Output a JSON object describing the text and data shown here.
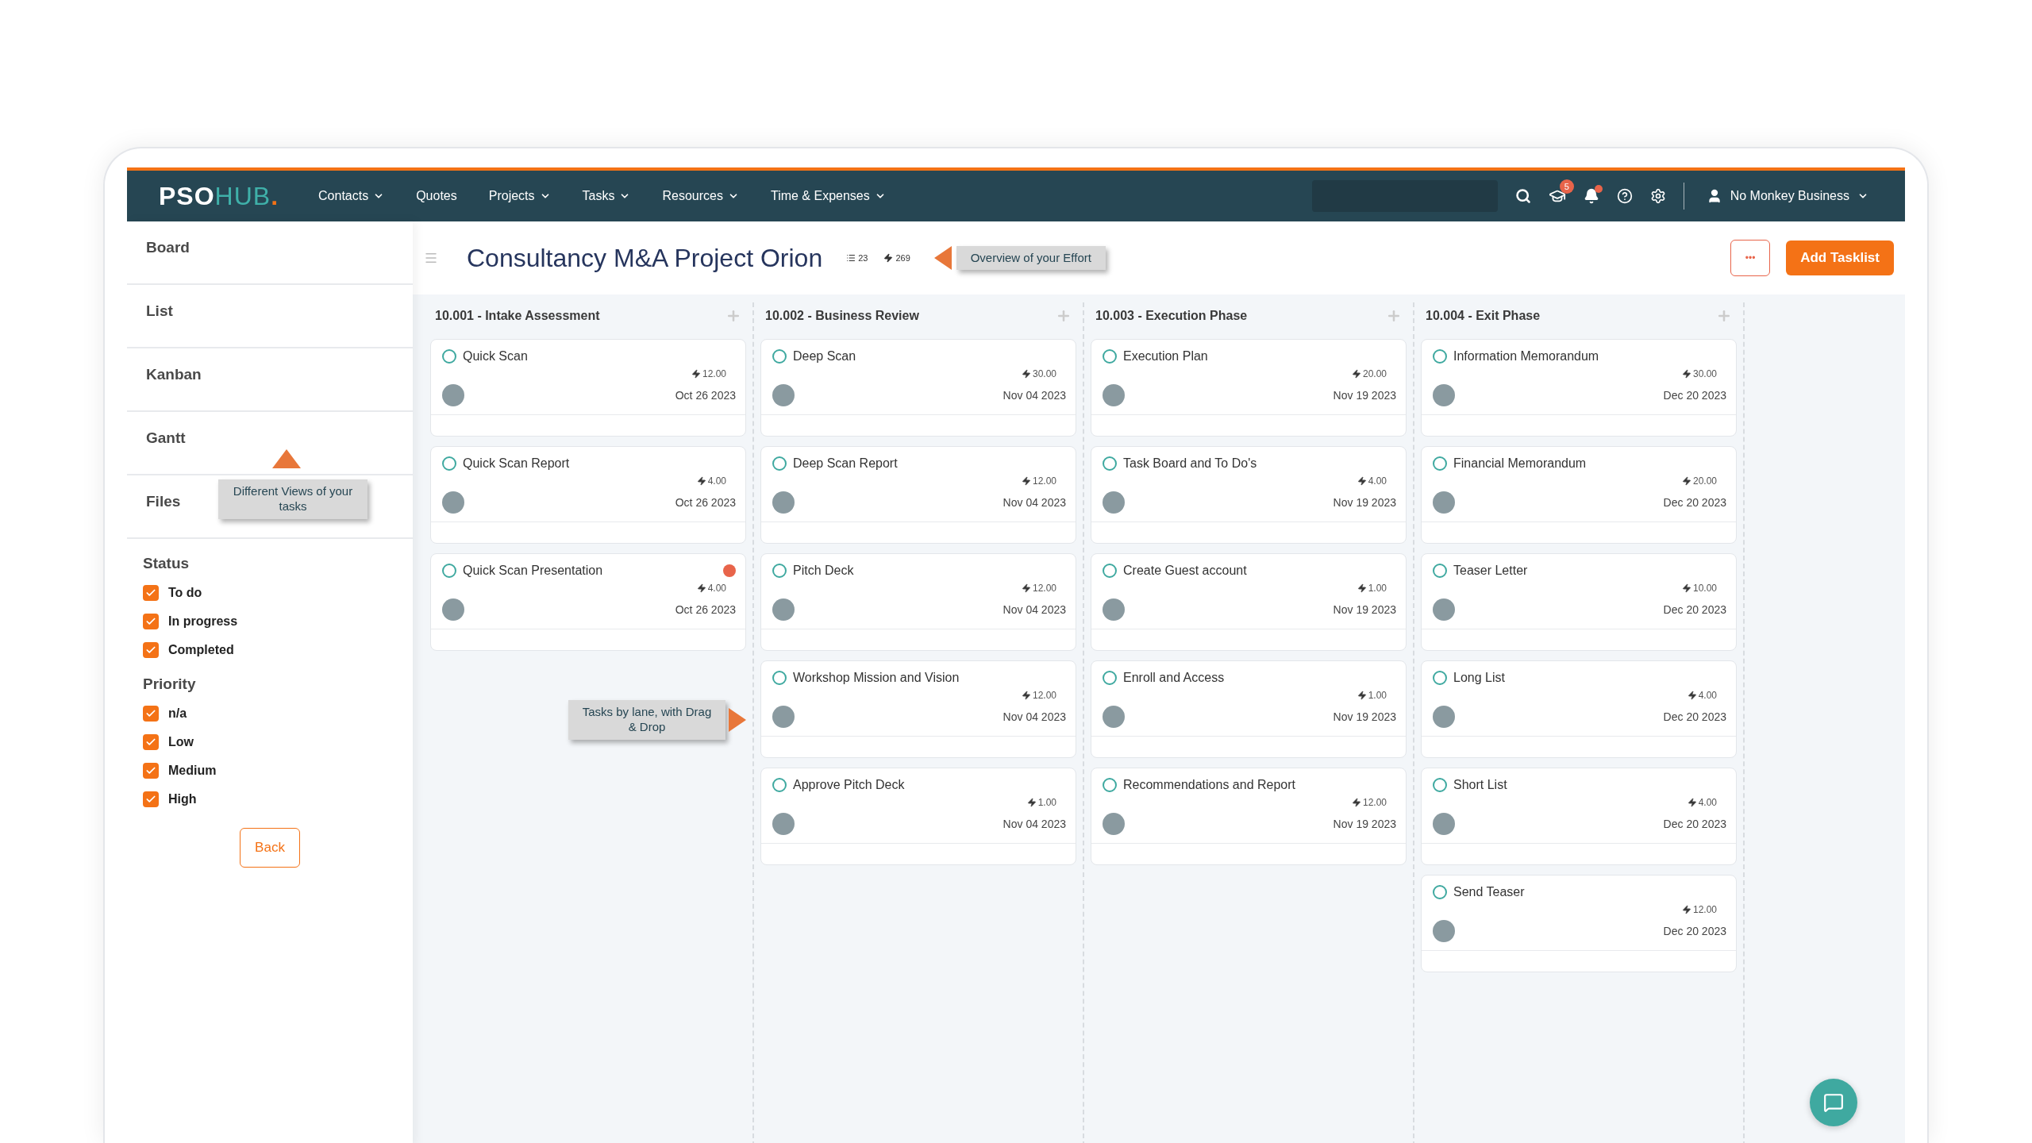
{
  "brand": {
    "main": "PSO",
    "accent": "HUB",
    "dot": "."
  },
  "nav": [
    {
      "label": "Contacts",
      "has_menu": true
    },
    {
      "label": "Quotes",
      "has_menu": false
    },
    {
      "label": "Projects",
      "has_menu": true
    },
    {
      "label": "Tasks",
      "has_menu": true
    },
    {
      "label": "Resources",
      "has_menu": true
    },
    {
      "label": "Time & Expenses",
      "has_menu": true
    }
  ],
  "header": {
    "notification_badge": "5",
    "bell_alert": true,
    "account": "No Monkey Business"
  },
  "views": [
    "Board",
    "List",
    "Kanban",
    "Gantt",
    "Files"
  ],
  "views_tip": "Different Views of your tasks",
  "filters": [
    {
      "title": "Status",
      "options": [
        {
          "label": "To do",
          "checked": true
        },
        {
          "label": "In progress",
          "checked": true
        },
        {
          "label": "Completed",
          "checked": true
        }
      ]
    },
    {
      "title": "Priority",
      "options": [
        {
          "label": "n/a",
          "checked": true
        },
        {
          "label": "Low",
          "checked": true
        },
        {
          "label": "Medium",
          "checked": true
        },
        {
          "label": "High",
          "checked": true
        }
      ]
    }
  ],
  "back_button": "Back",
  "project": {
    "title": "Consultancy M&A Project Orion",
    "task_count": "23",
    "effort_total": "269",
    "effort_tip": "Overview of your Effort"
  },
  "actions": {
    "more": "•••",
    "add": "Add Tasklist"
  },
  "lanes_tip": "Tasks by lane, with Drag & Drop",
  "lanes": [
    {
      "title": "10.001 - Intake Assessment",
      "cards": [
        {
          "title": "Quick Scan",
          "effort": "12.00",
          "date": "Oct 26 2023",
          "flagged": false
        },
        {
          "title": "Quick Scan Report",
          "effort": "4.00",
          "date": "Oct 26 2023",
          "flagged": false
        },
        {
          "title": "Quick Scan Presentation",
          "effort": "4.00",
          "date": "Oct 26 2023",
          "flagged": true
        }
      ]
    },
    {
      "title": "10.002 - Business Review",
      "cards": [
        {
          "title": "Deep Scan",
          "effort": "30.00",
          "date": "Nov 04 2023",
          "flagged": false
        },
        {
          "title": "Deep Scan Report",
          "effort": "12.00",
          "date": "Nov 04 2023",
          "flagged": false
        },
        {
          "title": "Pitch Deck",
          "effort": "12.00",
          "date": "Nov 04 2023",
          "flagged": false
        },
        {
          "title": "Workshop Mission and Vision",
          "effort": "12.00",
          "date": "Nov 04 2023",
          "flagged": false
        },
        {
          "title": "Approve Pitch Deck",
          "effort": "1.00",
          "date": "Nov 04 2023",
          "flagged": false
        }
      ]
    },
    {
      "title": "10.003 - Execution Phase",
      "cards": [
        {
          "title": "Execution Plan",
          "effort": "20.00",
          "date": "Nov 19 2023",
          "flagged": false
        },
        {
          "title": "Task Board and To Do's",
          "effort": "4.00",
          "date": "Nov 19 2023",
          "flagged": false
        },
        {
          "title": "Create Guest account",
          "effort": "1.00",
          "date": "Nov 19 2023",
          "flagged": false
        },
        {
          "title": "Enroll and Access",
          "effort": "1.00",
          "date": "Nov 19 2023",
          "flagged": false
        },
        {
          "title": "Recommendations and Report",
          "effort": "12.00",
          "date": "Nov 19 2023",
          "flagged": false
        }
      ]
    },
    {
      "title": "10.004 - Exit Phase",
      "cards": [
        {
          "title": "Information Memorandum",
          "effort": "30.00",
          "date": "Dec 20 2023",
          "flagged": false
        },
        {
          "title": "Financial Memorandum",
          "effort": "20.00",
          "date": "Dec 20 2023",
          "flagged": false
        },
        {
          "title": "Teaser Letter",
          "effort": "10.00",
          "date": "Dec 20 2023",
          "flagged": false
        },
        {
          "title": "Long List",
          "effort": "4.00",
          "date": "Dec 20 2023",
          "flagged": false
        },
        {
          "title": "Short List",
          "effort": "4.00",
          "date": "Dec 20 2023",
          "flagged": false
        },
        {
          "title": "Send Teaser",
          "effort": "12.00",
          "date": "Dec 20 2023",
          "flagged": false
        }
      ]
    }
  ]
}
